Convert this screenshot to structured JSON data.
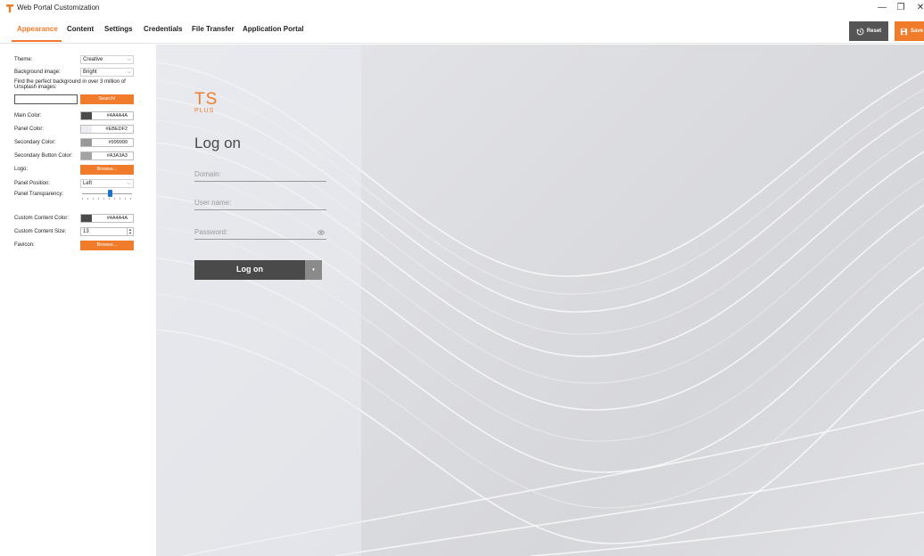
{
  "window": {
    "title": "Web Portal Customization",
    "controls": {
      "minimize": "—",
      "restore": "❐",
      "close": "✕"
    }
  },
  "tabs": [
    {
      "label": "Appearance",
      "active": true
    },
    {
      "label": "Content"
    },
    {
      "label": "Settings"
    },
    {
      "label": "Credentials"
    },
    {
      "label": "File Transfer"
    },
    {
      "label": "Application Portal"
    }
  ],
  "toolbar": {
    "reset_label": "Reset",
    "save_label": "Save"
  },
  "colors": {
    "accent": "#f07b2a",
    "dark_button": "#555555",
    "slider": "#1a73c9"
  },
  "settings": {
    "theme": {
      "label": "Theme:",
      "value": "Creative"
    },
    "background": {
      "label": "Background image:",
      "value": "Bright"
    },
    "unsplash": {
      "hint": "Find the perfect background in over 3 million of Unsplash images:",
      "value": "",
      "button": "Search!"
    },
    "main_color": {
      "label": "Main Color:",
      "value": "#4A4A4A"
    },
    "panel_color": {
      "label": "Panel Color:",
      "value": "#EBEDF2"
    },
    "secondary_color": {
      "label": "Secondary Color:",
      "value": "#999999"
    },
    "secondary_button_color": {
      "label": "Secondary Button Color:",
      "value": "#A3A3A3"
    },
    "logo": {
      "label": "Logo:",
      "button": "Browse..."
    },
    "panel_position": {
      "label": "Panel Position:",
      "value": "Left"
    },
    "panel_transparency": {
      "label": "Panel Transparency:",
      "value": 0.55
    },
    "custom_content_color": {
      "label": "Custom Content Color:",
      "value": "#4A4A4A"
    },
    "custom_content_size": {
      "label": "Custom Content Size:",
      "value": "13"
    },
    "favicon": {
      "label": "Favicon:",
      "button": "Browse..."
    }
  },
  "preview": {
    "logo_ts": "TS",
    "logo_plus": "PLUS",
    "title": "Log on",
    "domain_placeholder": "Domain:",
    "username_placeholder": "User name:",
    "password_placeholder": "Password:",
    "logon_button": "Log on",
    "dropdown_glyph": "▾"
  }
}
